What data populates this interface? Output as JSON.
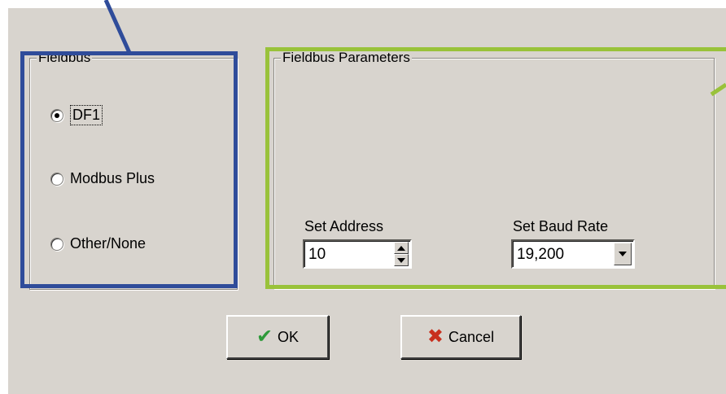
{
  "fieldbus_group": {
    "title": "Fieldbus",
    "options": [
      {
        "label": "DF1",
        "checked": true,
        "focused": true
      },
      {
        "label": "Modbus Plus",
        "checked": false
      },
      {
        "label": "Other/None",
        "checked": false
      }
    ]
  },
  "params_group": {
    "title": "Fieldbus Parameters",
    "address": {
      "label": "Set Address",
      "value": "10"
    },
    "baud": {
      "label": "Set Baud Rate",
      "value": "19,200"
    }
  },
  "buttons": {
    "ok": {
      "label": "OK",
      "icon": "checkmark-icon"
    },
    "cancel": {
      "label": "Cancel",
      "icon": "x-icon"
    }
  },
  "colors": {
    "dialog_bg": "#d8d4ce",
    "highlight_blue": "#2f4c9a",
    "highlight_green": "#99c23a",
    "ok_icon": "#2e9a3a",
    "cancel_icon": "#c8301e"
  }
}
